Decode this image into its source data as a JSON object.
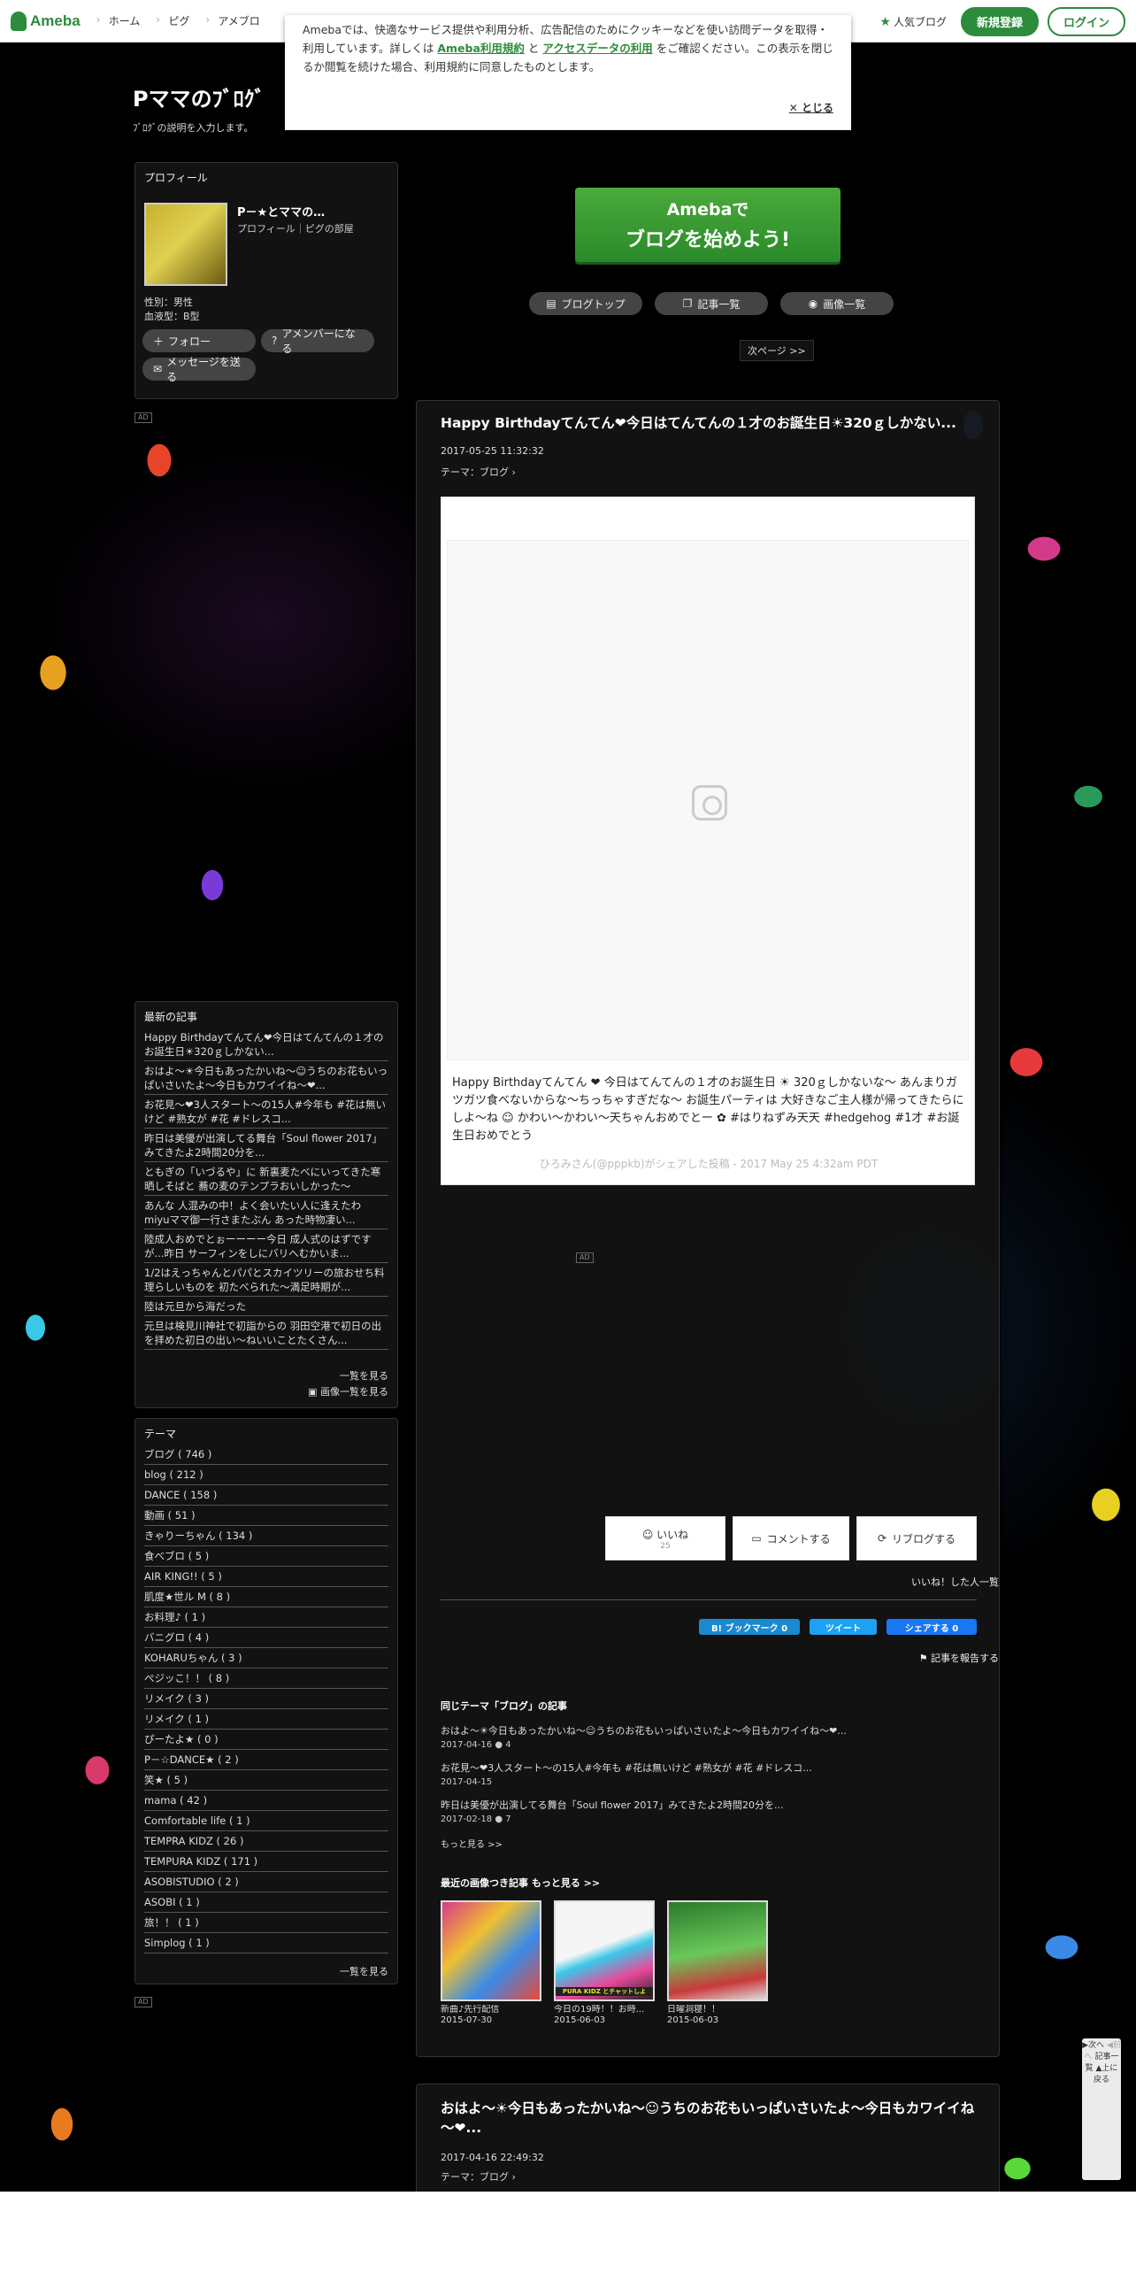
{
  "header": {
    "logo": "Ameba",
    "nav": [
      "ホーム",
      "ピグ",
      "アメブロ"
    ],
    "popular": "人気ブログ",
    "signup": "新規登録",
    "login": "ログイン"
  },
  "cookie": {
    "text1": "Amebaでは、快適なサービス提供や利用分析、広告配信のためにクッキーなどを使い訪問データを取得・利用しています。詳しくは ",
    "link1": "Ameba利用規約",
    "and": " と ",
    "link2": "アクセスデータの利用",
    "text2": " をご確認ください。この表示を閉じるか閲覧を続けた場合、利用規約に同意したものとします。",
    "close": "とじる"
  },
  "blog": {
    "title": "Pママのﾌﾞﾛｸﾞ",
    "desc": "ﾌﾞﾛｸﾞの説明を入力します。"
  },
  "profile": {
    "heading": "プロフィール",
    "name": "P－★とママの…",
    "links": "プロフィール｜ピグの部屋",
    "gender": "性別：男性",
    "blood": "血液型：B型",
    "follow": "フォロー",
    "member": "アメンバーになる",
    "message": "メッセージを送る"
  },
  "ad": "AD",
  "recent": {
    "heading": "最新の記事",
    "items": [
      "Happy Birthdayてんてん❤今日はてんてんの１才のお誕生日☀320ｇしかない...",
      "おはよ～☀今日もあったかいね～☺うちのお花もいっぱいさいたよ～今日もカワイイね～❤...",
      "お花見～❤3人スタート～の15人#今年も #花は無いけど #熟女が #花 #ドレスコ...",
      "昨日は美優が出演してる舞台「Soul flower 2017」みてきたよ2時間20分を...",
      "ともぎの「いづるや」に 新裏麦たべにいってきた寒晒しそばと 蕎の麦のテンプラおいしかった～",
      "あんな 人混みの中！よく会いたい人に逢えたわ miyuママ御一行さまたぶん あった時物凄い...",
      "陸成人おめでとぉーーーー今日 成人式のはずですが...昨日 サーフィンをしにバリへむかいま...",
      "1/2はえっちゃんとパパとスカイツリーの旅おせち料理らしいものを 初たべられた～満足時期が...",
      "陸は元旦から海だった",
      "元旦は検見川神社で初詣からの 羽田空港で初日の出を拝めた初日の出い～ねいいことたくさん..."
    ],
    "more": "一覧を見る",
    "imagelist": "画像一覧を見る"
  },
  "theme": {
    "heading": "テーマ",
    "items": [
      "ブログ ( 746 )",
      "blog ( 212 )",
      "DANCE ( 158 )",
      "動画 ( 51 )",
      "きゃりーちゃん ( 134 )",
      "食べブロ ( 5 )",
      "AIR KING!! ( 5 )",
      "肌度★世ル M ( 8 )",
      "お料理♪ ( 1 )",
      "バニグロ ( 4 )",
      "KOHARUちゃん ( 3 )",
      "ぺジッこ！！ ( 8 )",
      "リメイク ( 3 )",
      "リメイク ( 1 )",
      "ぴーたよ★ ( 0 )",
      "P－☆DANCE★ ( 2 )",
      "笑★ ( 5 )",
      "mama ( 42 )",
      "Comfortable life ( 1 )",
      "TEMPRA KIDZ ( 26 )",
      "TEMPURA KIDZ ( 171 )",
      "ASOBISTUDIO ( 2 )",
      "ASOBI ( 1 )",
      "旅！！ ( 1 )",
      "Simplog ( 1 )"
    ],
    "more": "一覧を見る"
  },
  "cta": {
    "line1": "Amebaで",
    "line2": "ブログを始めよう!"
  },
  "blognav": {
    "top": "ブログトップ",
    "list": "記事一覧",
    "images": "画像一覧",
    "next": "次ページ >>"
  },
  "article": {
    "title": "Happy Birthdayてんてん❤今日はてんてんの１才のお誕生日☀320ｇしかない...",
    "date": "2017-05-25 11:32:32",
    "theme": "テーマ：ブログ",
    "caption": "Happy Birthdayてんてん ❤ 今日はてんてんの１才のお誕生日 ☀ 320ｇしかないな～ あんまりガツガツ食べないからな～ちっちゃすぎだな～ お誕生パーティは 大好きなご主人様が帰ってきたらにしよ～ね ☺ かわい～かわい～天ちゃんおめでとー ✿ #はりねずみ天天 #hedgehog #1才 #お誕生日おめでとう",
    "source": "ひろみさん(@pppkb)がシェアした投稿 - 2017 May 25 4:32am PDT",
    "like": "いいね",
    "likecount": "25",
    "comment": "コメントする",
    "reblog": "リブログする",
    "likelist": "いいね！した人一覧",
    "hatena": "B! ブックマーク 0",
    "tweet": "ツイート",
    "fbshare": "シェアする 0",
    "report": "記事を報告する"
  },
  "same": {
    "heading": "同じテーマ「ブログ」の記事",
    "items": [
      {
        "title": "おはよ～☀今日もあったかいね～☺うちのお花もいっぱいさいたよ～今日もカワイイね～❤...",
        "date": "2017-04-16",
        "count": "4"
      },
      {
        "title": "お花見～❤3人スタート～の15人#今年も #花は無いけど #熟女が #花 #ドレスコ...",
        "date": "2017-04-15",
        "count": ""
      },
      {
        "title": "昨日は美優が出演してる舞台「Soul flower 2017」みてきたよ2時間20分を...",
        "date": "2017-02-18",
        "count": "7"
      }
    ],
    "more": "もっと見る >>"
  },
  "images": {
    "heading": "最近の画像つき記事",
    "more": "もっと見る >>",
    "items": [
      {
        "title": "新曲♪先行配信",
        "date": "2015-07-30"
      },
      {
        "title": "今日の19時！！お時...",
        "date": "2015-06-03"
      },
      {
        "title": "日曜洞寝！！",
        "date": "2015-06-03"
      }
    ],
    "thumb2label": "PURA KIDZ とチャットしよ"
  },
  "article2": {
    "title": "おはよ～☀今日もあったかいね～☺うちのお花もいっぱいさいたよ～今日もカワイイね～❤...",
    "date": "2017-04-16 22:49:32",
    "theme": "テーマ：ブログ"
  },
  "sidefloat": {
    "next": "次へ",
    "prev": "前へ",
    "list": "記事一覧",
    "top": "上に戻る"
  }
}
